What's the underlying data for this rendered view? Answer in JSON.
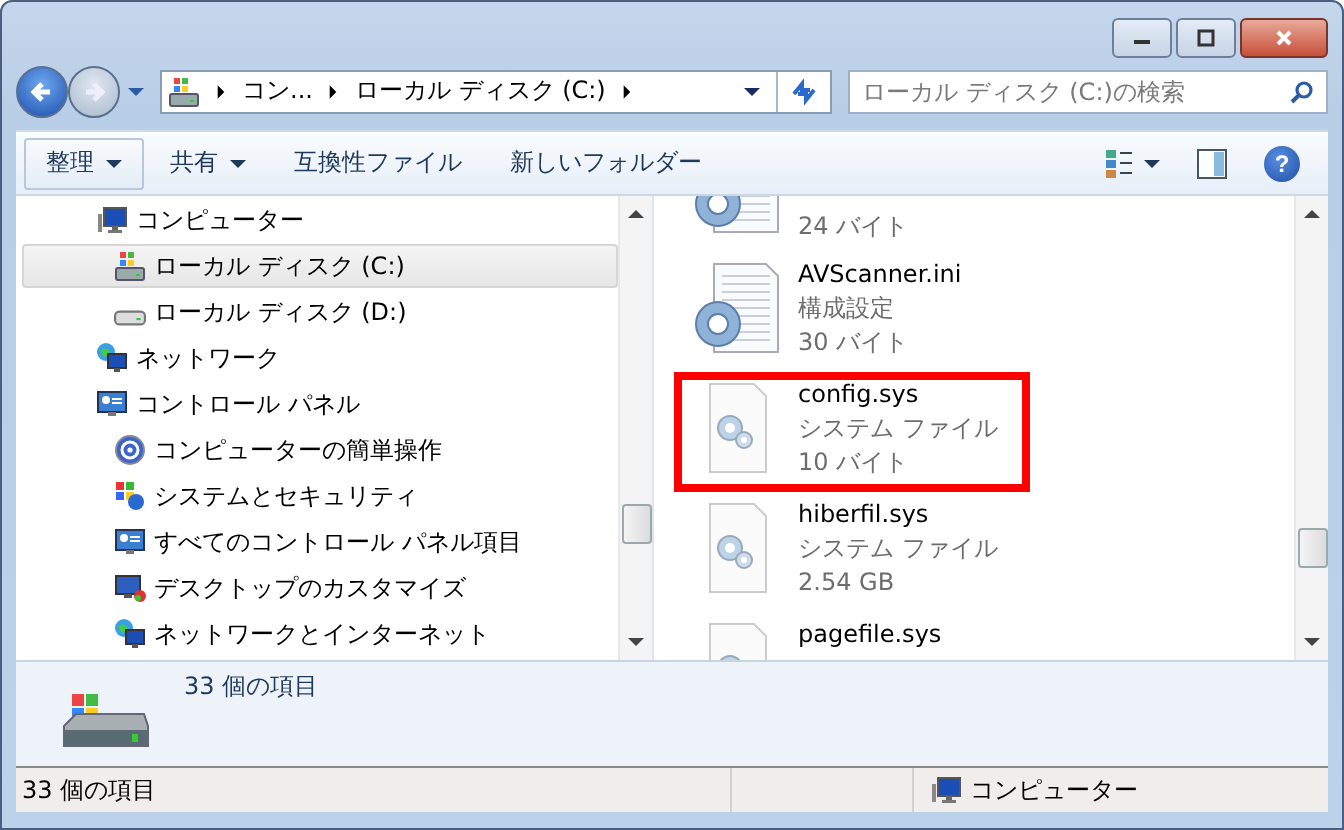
{
  "address": {
    "crumbs": [
      "コン...",
      "ローカル ディスク (C:)"
    ]
  },
  "search": {
    "placeholder": "ローカル ディスク (C:)の検索"
  },
  "toolbar": {
    "buttons": [
      {
        "label": "整理",
        "dropdown": true
      },
      {
        "label": "共有",
        "dropdown": true
      },
      {
        "label": "互換性ファイル",
        "dropdown": false
      },
      {
        "label": "新しいフォルダー",
        "dropdown": false
      }
    ],
    "help": "?"
  },
  "sidebar": {
    "items": [
      {
        "label": "コンピューター",
        "kind": "computer",
        "selected": false,
        "children": [
          {
            "label": "ローカル ディスク (C:)",
            "kind": "windrive",
            "selected": true
          },
          {
            "label": "ローカル ディスク (D:)",
            "kind": "drive",
            "selected": false
          }
        ]
      },
      {
        "label": "ネットワーク",
        "kind": "network",
        "selected": false
      },
      {
        "label": "コントロール パネル",
        "kind": "panel",
        "selected": false,
        "children": [
          {
            "label": "コンピューターの簡単操作",
            "kind": "ease",
            "selected": false
          },
          {
            "label": "システムとセキュリティ",
            "kind": "shield",
            "selected": false
          },
          {
            "label": "すべてのコントロール パネル項目",
            "kind": "panel",
            "selected": false
          },
          {
            "label": "デスクトップのカスタマイズ",
            "kind": "desktop",
            "selected": false
          },
          {
            "label": "ネットワークとインターネット",
            "kind": "network",
            "selected": false
          }
        ]
      }
    ]
  },
  "files": [
    {
      "size": "24 バイト",
      "kind": "ini",
      "highlighted": false
    },
    {
      "name": "AVScanner.ini",
      "type": "構成設定",
      "size": "30 バイト",
      "kind": "ini",
      "highlighted": false
    },
    {
      "name": "config.sys",
      "type": "システム ファイル",
      "size": "10 バイト",
      "kind": "sys",
      "highlighted": true
    },
    {
      "name": "hiberfil.sys",
      "type": "システム ファイル",
      "size": "2.54 GB",
      "kind": "sys",
      "highlighted": false
    },
    {
      "name": "pagefile.sys",
      "kind": "sys",
      "highlighted": false
    }
  ],
  "details": {
    "count": "33 個の項目"
  },
  "status_bar": {
    "count": "33 個の項目",
    "location": "コンピューター"
  }
}
